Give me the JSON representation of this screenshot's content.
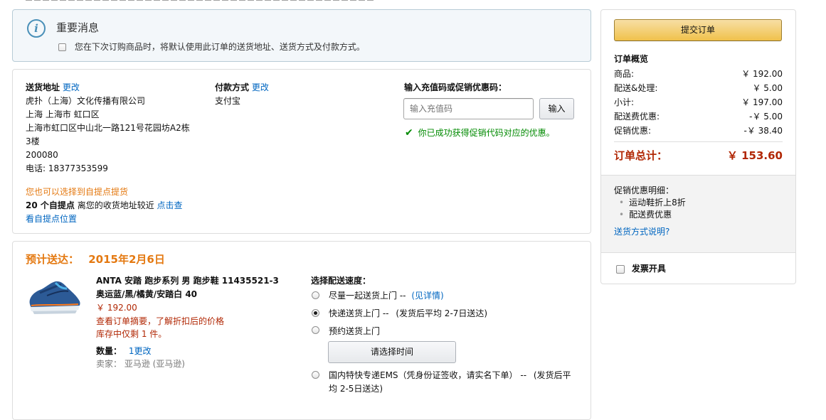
{
  "notice": {
    "title": "重要消息",
    "checkbox_label": "您在下次订购商品时，将默认使用此订单的送货地址、送货方式及付款方式。"
  },
  "shipping": {
    "heading": "送货地址",
    "change": "更改",
    "lines": [
      "虎扑（上海）文化传播有限公司",
      "上海 上海市 虹口区",
      "上海市虹口区中山北一路121号花园坊A2栋",
      "3楼",
      "200080",
      "电话: 18377353599"
    ],
    "pickup_hint": "您也可以选择到自提点提货",
    "pickup_count": "20 个自提点",
    "pickup_text": " 离您的收货地址较近 ",
    "pickup_link": "点击查",
    "pickup_link2": "看自提点位置"
  },
  "payment": {
    "heading": "付款方式",
    "change": "更改",
    "method": "支付宝"
  },
  "promo": {
    "heading": "输入充值码或促销优惠码：",
    "placeholder": "输入充值码",
    "button": "输入",
    "success": "你已成功获得促销代码对应的优惠。"
  },
  "delivery": {
    "estimate_label": "预计送达：",
    "estimate_date": "2015年2月6日",
    "item": {
      "title_line1": "ANTA 安踏 跑步系列 男 跑步鞋 11435521-3",
      "title_line2": "奥运蓝/黑/橘黄/安踏白 40",
      "price": "￥ 192.00",
      "summary_note": "查看订单摘要，了解折扣后的价格",
      "stock": "库存中仅剩 1 件。",
      "qty_label": "数量：",
      "qty": "1",
      "qty_change": "更改",
      "seller": "卖家：  亚马逊 (亚马逊)"
    },
    "speed": {
      "heading": "选择配送速度：",
      "options": [
        {
          "label": "尽量一起送货上门 --",
          "extra": "(见详情)",
          "selected": false
        },
        {
          "label": "快递送货上门 --",
          "extra": "(发货后平均 2-7日送达)",
          "selected": true
        },
        {
          "label": "预约送货上门",
          "extra": "",
          "selected": false
        },
        {
          "label": "国内特快专递EMS（凭身份证签收，请实名下单） --",
          "extra": "(发货后平均 2-5日送达)",
          "selected": false
        }
      ],
      "time_button": "请选择时间"
    }
  },
  "summary": {
    "submit": "提交订单",
    "title": "订单概览",
    "rows": [
      {
        "label": "商品:",
        "value": "￥ 192.00"
      },
      {
        "label": "配送&处理:",
        "value": "￥ 5.00"
      },
      {
        "label": "小计:",
        "value": "￥ 197.00"
      },
      {
        "label": "配送费优惠:",
        "value": "-￥ 5.00"
      },
      {
        "label": "促销优惠:",
        "value": "-￥ 38.40"
      }
    ],
    "total_label": "订单总计：",
    "total_value": "￥ 153.60",
    "promo_details_title": "促销优惠明细：",
    "promo_details": [
      "运动鞋折上8折",
      "配送费优惠"
    ],
    "shipping_help": "送货方式说明?",
    "invoice": "发票开具"
  },
  "colors": {
    "link": "#0066c0",
    "orange_heading": "#e47911",
    "price_red": "#b12704",
    "success_green": "#008a00",
    "notice_bg": "#f1f6fa"
  }
}
